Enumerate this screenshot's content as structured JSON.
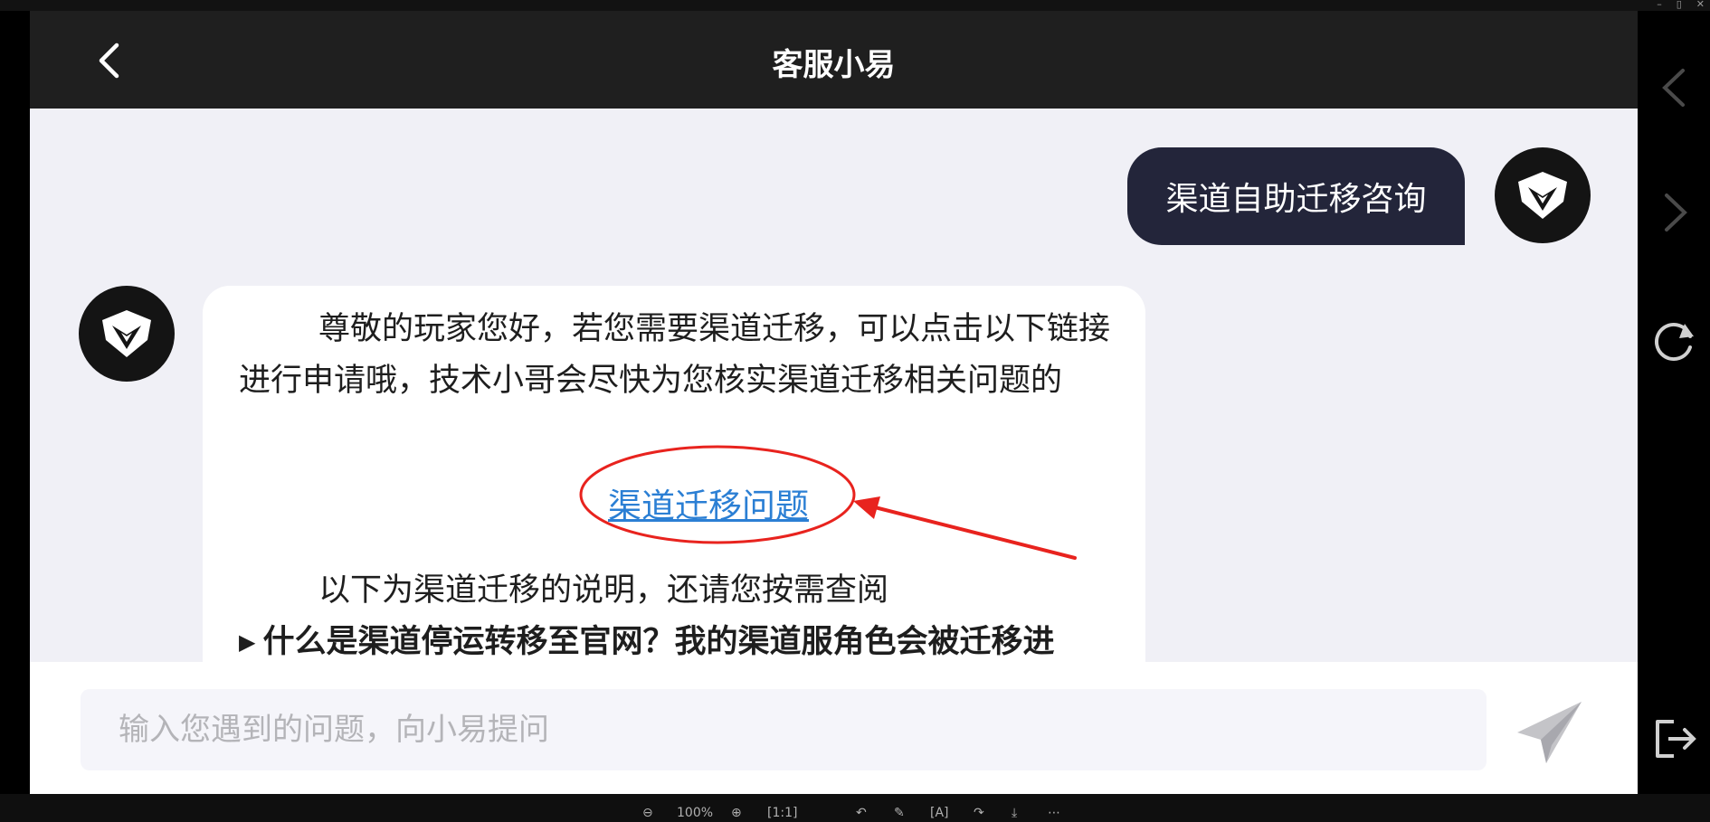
{
  "header": {
    "title": "客服小易"
  },
  "chat": {
    "user_message": "渠道自助迁移咨询",
    "bot_message": {
      "intro": "尊敬的玩家您好，若您需要渠道迁移，可以点击以下链接进行申请哦，技术小哥会尽快为您核实渠道迁移相关问题的",
      "link_text": "渠道迁移问题",
      "note": "以下为渠道迁移的说明，还请您按需查阅",
      "faq_arrow": "▶",
      "faq_item": "什么是渠道停运转移至官网？我的渠道服角色会被迁移进"
    }
  },
  "input": {
    "placeholder": "输入您遇到的问题，向小易提问"
  },
  "viewer_toolbar": {
    "zoom_out": "⊖",
    "zoom_level": "100%",
    "zoom_in": "⊕",
    "fit": "[1:1]",
    "rotate_left": "↶",
    "edit": "✎",
    "ocr": "[A]",
    "rotate_right": "↷",
    "download": "⤓",
    "more": "⋯"
  },
  "window_controls": {
    "minimize": "–",
    "maximize": "▯",
    "close": "✕"
  },
  "colors": {
    "header_bg": "#1f1f1f",
    "chat_bg": "#f0f0f6",
    "user_bubble": "#23253a",
    "link": "#2b7fd4",
    "annotation": "#e8231e"
  },
  "icons": [
    "back-arrow-icon",
    "avatar-logo-icon",
    "send-plane-icon",
    "nav-prev-icon",
    "nav-next-icon",
    "refresh-icon",
    "exit-icon"
  ]
}
